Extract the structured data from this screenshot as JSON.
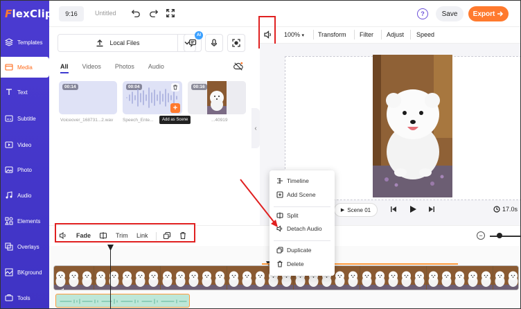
{
  "app": {
    "logo_text": "FlexClip"
  },
  "topbar": {
    "ratio": "9:16",
    "title": "Untitled",
    "help": "?",
    "save_label": "Save",
    "export_label": "Export"
  },
  "sidebar": {
    "items": [
      {
        "label": "Templates",
        "icon": "layers-icon"
      },
      {
        "label": "Media",
        "icon": "media-icon",
        "active": true
      },
      {
        "label": "Text",
        "icon": "text-icon"
      },
      {
        "label": "Subtitle",
        "icon": "subtitle-icon"
      },
      {
        "label": "Video",
        "icon": "video-icon"
      },
      {
        "label": "Photo",
        "icon": "photo-icon"
      },
      {
        "label": "Audio",
        "icon": "music-icon"
      },
      {
        "label": "Elements",
        "icon": "elements-icon"
      },
      {
        "label": "Overlays",
        "icon": "overlays-icon"
      },
      {
        "label": "BKground",
        "icon": "background-icon"
      },
      {
        "label": "Tools",
        "icon": "tools-icon"
      }
    ]
  },
  "media_panel": {
    "local_files_label": "Local Files",
    "ai_badge": "AI",
    "tabs": [
      "All",
      "Videos",
      "Photos",
      "Audio"
    ],
    "items": [
      {
        "duration": "00:14",
        "caption": "Voiceover_168731...2.wav"
      },
      {
        "duration": "00:04",
        "caption": "Speech_Ente..."
      },
      {
        "duration": "00:16",
        "caption": "...40919"
      }
    ],
    "tooltip": "Add as Scene",
    "add_symbol": "+"
  },
  "editor_toolbar": {
    "zoom": "100%",
    "items": [
      "Transform",
      "Filter",
      "Adjust",
      "Speed"
    ]
  },
  "player": {
    "scene_label": "Scene 01",
    "duration": "17.0s"
  },
  "context_menu": {
    "items": [
      "Timeline",
      "Add Scene",
      "Split",
      "Detach Audio",
      "Duplicate",
      "Delete"
    ]
  },
  "timeline_toolbar": {
    "fade": "Fade",
    "trim": "Trim",
    "link": "Link",
    "zoom_minus": "−"
  },
  "colors": {
    "sidebar": "#4338ca",
    "accent_orange": "#ff7a2e",
    "highlight_red": "#e02020"
  }
}
